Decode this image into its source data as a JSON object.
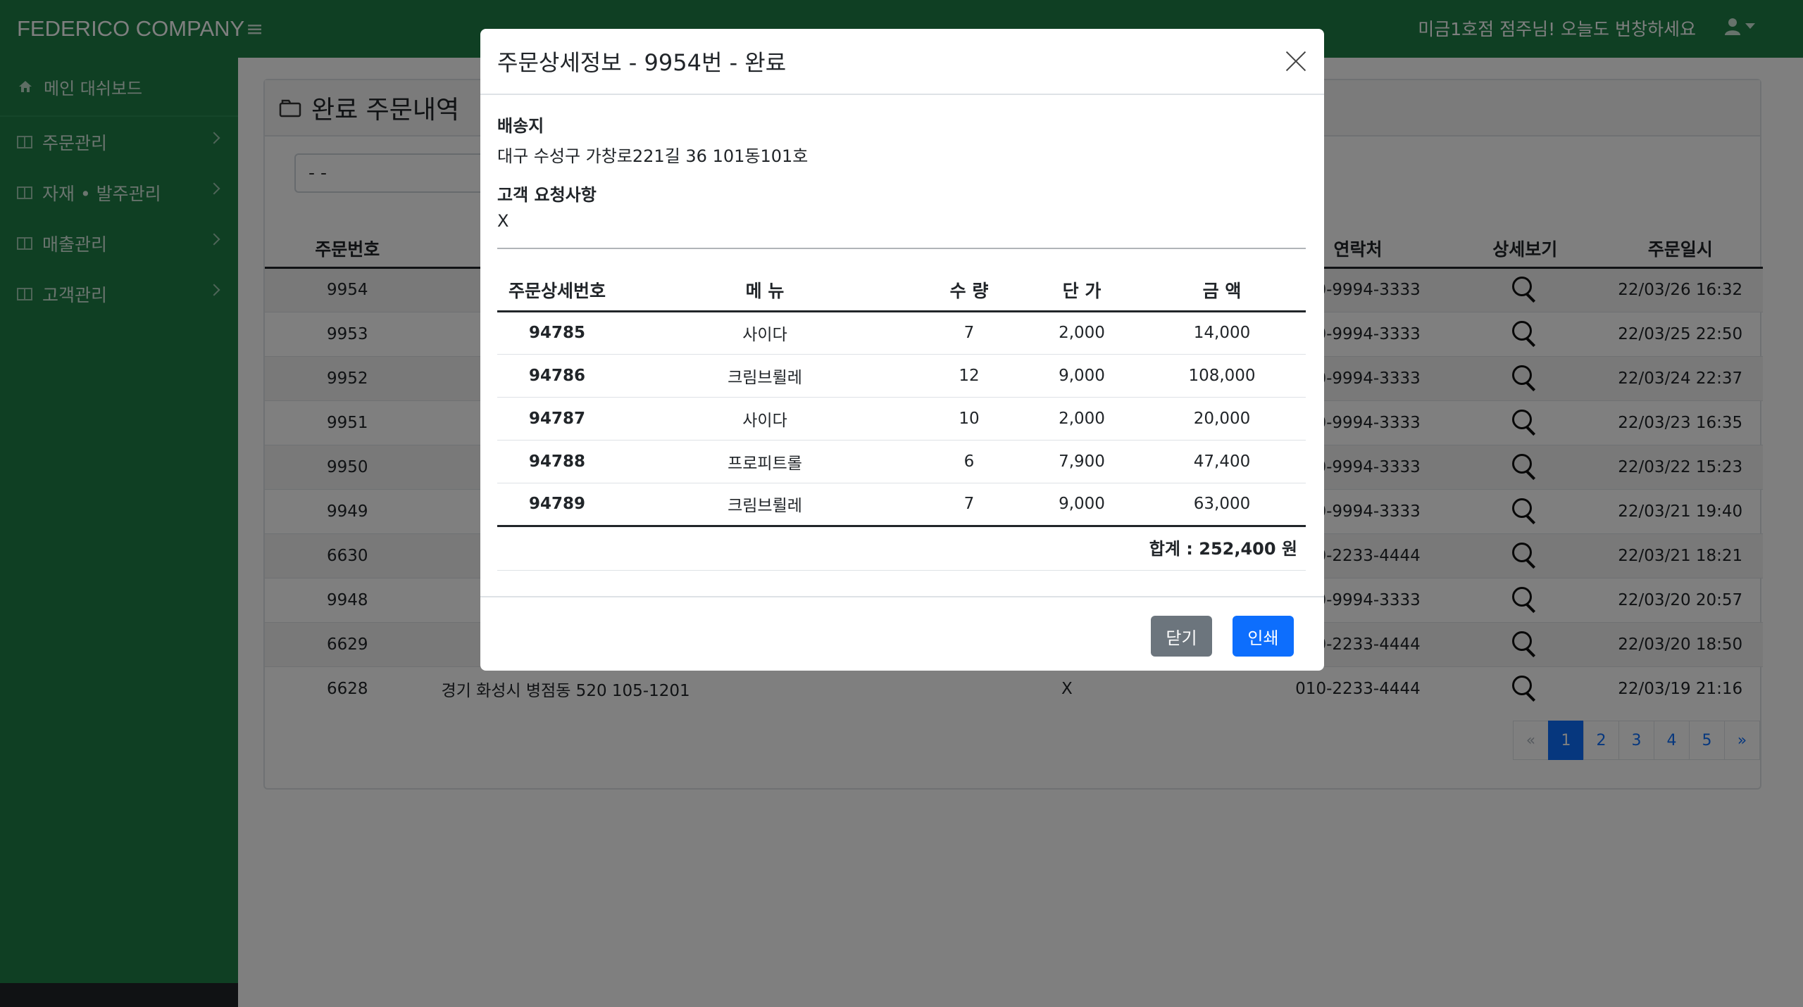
{
  "app": {
    "brand": "FEDERICO COMPANY",
    "greeting": "미금1호점 점주님! 오늘도 번창하세요"
  },
  "sidebar": {
    "dashboard": "메인 대쉬보드",
    "items": [
      {
        "label": "주문관리"
      },
      {
        "label": "자재 • 발주관리"
      },
      {
        "label": "매출관리"
      },
      {
        "label": "고객관리"
      }
    ]
  },
  "page": {
    "title": "완료 주문내역",
    "filter_value": "- -"
  },
  "orders": {
    "headers": {
      "no": "주문번호",
      "phone": "연락처",
      "view": "상세보기",
      "date": "주문일시"
    },
    "rows": [
      {
        "no": "9954",
        "addr": "",
        "req": "",
        "phone": "010-9994-3333",
        "date": "22/03/26 16:32"
      },
      {
        "no": "9953",
        "addr": "",
        "req": "",
        "phone": "010-9994-3333",
        "date": "22/03/25 22:50"
      },
      {
        "no": "9952",
        "addr": "",
        "req": "",
        "phone": "010-9994-3333",
        "date": "22/03/24 22:37"
      },
      {
        "no": "9951",
        "addr": "",
        "req": "",
        "phone": "010-9994-3333",
        "date": "22/03/23 16:35"
      },
      {
        "no": "9950",
        "addr": "",
        "req": "",
        "phone": "010-9994-3333",
        "date": "22/03/22 15:23"
      },
      {
        "no": "9949",
        "addr": "",
        "req": "",
        "phone": "010-9994-3333",
        "date": "22/03/21 19:40"
      },
      {
        "no": "6630",
        "addr": "",
        "req": "",
        "phone": "010-2233-4444",
        "date": "22/03/21 18:21"
      },
      {
        "no": "9948",
        "addr": "",
        "req": "",
        "phone": "010-9994-3333",
        "date": "22/03/20 20:57"
      },
      {
        "no": "6629",
        "addr": "",
        "req": "",
        "phone": "010-2233-4444",
        "date": "22/03/20 18:50"
      },
      {
        "no": "6628",
        "addr": "경기 화성시 병점동 520 105-1201",
        "req": "X",
        "phone": "010-2233-4444",
        "date": "22/03/19 21:16"
      }
    ]
  },
  "pagination": {
    "prev": "«",
    "pages": [
      "1",
      "2",
      "3",
      "4",
      "5"
    ],
    "next": "»",
    "current": "1"
  },
  "modal": {
    "title": "주문상세정보 - 9954번 - 완료",
    "address_label": "배송지",
    "address": "대구 수성구 가창로221길 36 101동101호",
    "request_label": "고객 요청사항",
    "request": "X",
    "headers": {
      "id": "주문상세번호",
      "menu": "메 뉴",
      "qty": "수 량",
      "price": "단 가",
      "amount": "금 액"
    },
    "items": [
      {
        "id": "94785",
        "menu": "사이다",
        "qty": "7",
        "price": "2,000",
        "amount": "14,000"
      },
      {
        "id": "94786",
        "menu": "크림브륄레",
        "qty": "12",
        "price": "9,000",
        "amount": "108,000"
      },
      {
        "id": "94787",
        "menu": "사이다",
        "qty": "10",
        "price": "2,000",
        "amount": "20,000"
      },
      {
        "id": "94788",
        "menu": "프로피트롤",
        "qty": "6",
        "price": "7,900",
        "amount": "47,400"
      },
      {
        "id": "94789",
        "menu": "크림브륄레",
        "qty": "7",
        "price": "9,000",
        "amount": "63,000"
      }
    ],
    "total": "합계 : 252,400 원",
    "close_label": "닫기",
    "print_label": "인쇄"
  },
  "colors": {
    "sidebar": "#1e7e47",
    "primary": "#0d6efd",
    "secondary": "#6c757d"
  }
}
